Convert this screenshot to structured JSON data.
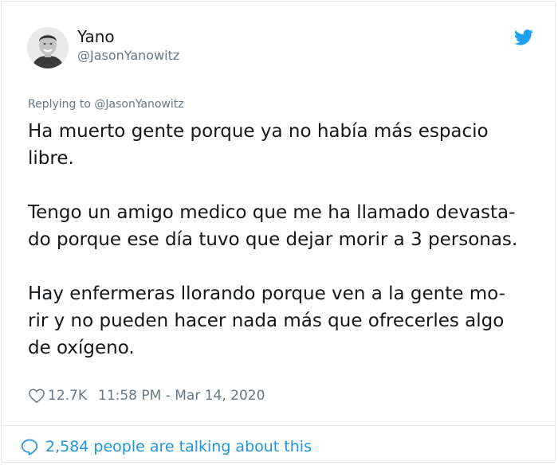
{
  "author": {
    "display_name": "Yano",
    "handle": "@JasonYanowitz"
  },
  "reply": {
    "text": "Replying to @JasonYanowitz"
  },
  "tweet": {
    "paragraphs": [
      "Ha muerto gente porque ya no había más espacio\nlibre.",
      "Tengo un amigo medico que me ha llamado devasta-\ndo porque ese día tuvo que dejar morir a 3 personas.",
      "Hay enfermeras llorando porque ven a la gente mo-\nrir y no pueden hacer nada más que ofrecerles algo\nde oxígeno."
    ]
  },
  "meta": {
    "likes": "12.7K",
    "timestamp": "11:58 PM - Mar 14, 2020"
  },
  "footer": {
    "talking_text": "2,584 people are talking about this"
  },
  "icons": {
    "logo": "twitter-bird-icon",
    "like": "heart-icon",
    "conversation": "speech-bubble-icon"
  },
  "colors": {
    "brand": "#1da1f2",
    "link": "#1b95e0",
    "secondary_text": "#657786",
    "primary_text": "#14171a",
    "border": "#e1e8ed"
  }
}
